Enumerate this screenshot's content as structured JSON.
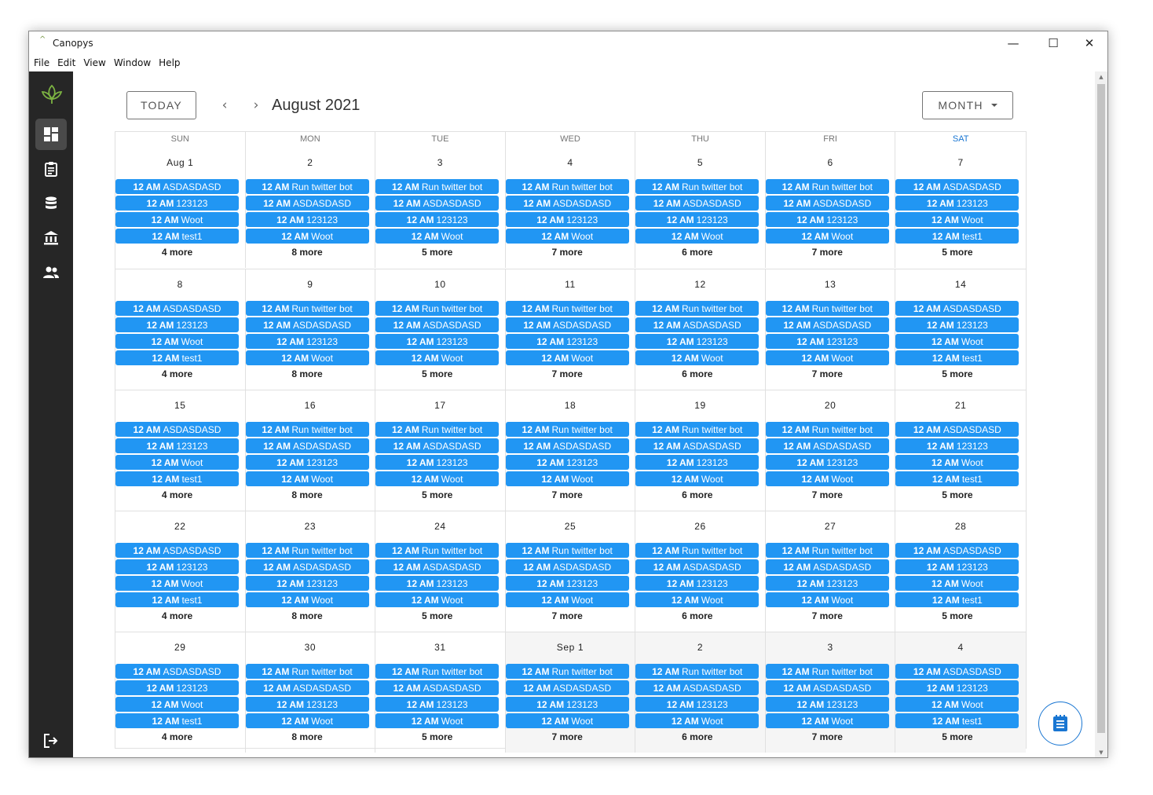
{
  "window": {
    "title": "Canopys",
    "app_icon": "^",
    "controls": {
      "minimize": "—",
      "maximize": "☐",
      "close": "✕"
    }
  },
  "menubar": [
    "File",
    "Edit",
    "View",
    "Window",
    "Help"
  ],
  "sidebar": {
    "logo": "canopy-leaf-logo",
    "items": [
      {
        "icon": "dashboard-icon",
        "active": true
      },
      {
        "icon": "clipboard-icon",
        "active": false
      },
      {
        "icon": "database-icon",
        "active": false
      },
      {
        "icon": "bank-icon",
        "active": false
      },
      {
        "icon": "people-icon",
        "active": false
      }
    ],
    "bottom_icon": "logout-icon"
  },
  "toolbar": {
    "today_label": "TODAY",
    "prev_icon": "‹",
    "next_icon": "›",
    "month_label": "August 2021",
    "view_label": "MONTH"
  },
  "calendar": {
    "days_of_week": [
      "SUN",
      "MON",
      "TUE",
      "WED",
      "THU",
      "FRI",
      "SAT"
    ],
    "weeks": [
      [
        {
          "label": "Aug 1",
          "events": [
            "ASDASDASD",
            "123123",
            "Woot",
            "test1"
          ],
          "more": "4 more"
        },
        {
          "label": "2",
          "events": [
            "Run twitter bot",
            "ASDASDASD",
            "123123",
            "Woot"
          ],
          "more": "8 more"
        },
        {
          "label": "3",
          "events": [
            "Run twitter bot",
            "ASDASDASD",
            "123123",
            "Woot"
          ],
          "more": "5 more"
        },
        {
          "label": "4",
          "events": [
            "Run twitter bot",
            "ASDASDASD",
            "123123",
            "Woot"
          ],
          "more": "7 more"
        },
        {
          "label": "5",
          "events": [
            "Run twitter bot",
            "ASDASDASD",
            "123123",
            "Woot"
          ],
          "more": "6 more"
        },
        {
          "label": "6",
          "events": [
            "Run twitter bot",
            "ASDASDASD",
            "123123",
            "Woot"
          ],
          "more": "7 more"
        },
        {
          "label": "7",
          "events": [
            "ASDASDASD",
            "123123",
            "Woot",
            "test1"
          ],
          "more": "5 more"
        }
      ],
      [
        {
          "label": "8",
          "events": [
            "ASDASDASD",
            "123123",
            "Woot",
            "test1"
          ],
          "more": "4 more"
        },
        {
          "label": "9",
          "events": [
            "Run twitter bot",
            "ASDASDASD",
            "123123",
            "Woot"
          ],
          "more": "8 more"
        },
        {
          "label": "10",
          "events": [
            "Run twitter bot",
            "ASDASDASD",
            "123123",
            "Woot"
          ],
          "more": "5 more"
        },
        {
          "label": "11",
          "events": [
            "Run twitter bot",
            "ASDASDASD",
            "123123",
            "Woot"
          ],
          "more": "7 more"
        },
        {
          "label": "12",
          "events": [
            "Run twitter bot",
            "ASDASDASD",
            "123123",
            "Woot"
          ],
          "more": "6 more"
        },
        {
          "label": "13",
          "events": [
            "Run twitter bot",
            "ASDASDASD",
            "123123",
            "Woot"
          ],
          "more": "7 more"
        },
        {
          "label": "14",
          "events": [
            "ASDASDASD",
            "123123",
            "Woot",
            "test1"
          ],
          "more": "5 more"
        }
      ],
      [
        {
          "label": "15",
          "events": [
            "ASDASDASD",
            "123123",
            "Woot",
            "test1"
          ],
          "more": "4 more"
        },
        {
          "label": "16",
          "events": [
            "Run twitter bot",
            "ASDASDASD",
            "123123",
            "Woot"
          ],
          "more": "8 more"
        },
        {
          "label": "17",
          "events": [
            "Run twitter bot",
            "ASDASDASD",
            "123123",
            "Woot"
          ],
          "more": "5 more"
        },
        {
          "label": "18",
          "events": [
            "Run twitter bot",
            "ASDASDASD",
            "123123",
            "Woot"
          ],
          "more": "7 more"
        },
        {
          "label": "19",
          "events": [
            "Run twitter bot",
            "ASDASDASD",
            "123123",
            "Woot"
          ],
          "more": "6 more"
        },
        {
          "label": "20",
          "events": [
            "Run twitter bot",
            "ASDASDASD",
            "123123",
            "Woot"
          ],
          "more": "7 more"
        },
        {
          "label": "21",
          "events": [
            "ASDASDASD",
            "123123",
            "Woot",
            "test1"
          ],
          "more": "5 more"
        }
      ],
      [
        {
          "label": "22",
          "events": [
            "ASDASDASD",
            "123123",
            "Woot",
            "test1"
          ],
          "more": "4 more"
        },
        {
          "label": "23",
          "events": [
            "Run twitter bot",
            "ASDASDASD",
            "123123",
            "Woot"
          ],
          "more": "8 more"
        },
        {
          "label": "24",
          "events": [
            "Run twitter bot",
            "ASDASDASD",
            "123123",
            "Woot"
          ],
          "more": "5 more"
        },
        {
          "label": "25",
          "events": [
            "Run twitter bot",
            "ASDASDASD",
            "123123",
            "Woot"
          ],
          "more": "7 more"
        },
        {
          "label": "26",
          "events": [
            "Run twitter bot",
            "ASDASDASD",
            "123123",
            "Woot"
          ],
          "more": "6 more"
        },
        {
          "label": "27",
          "events": [
            "Run twitter bot",
            "ASDASDASD",
            "123123",
            "Woot"
          ],
          "more": "7 more"
        },
        {
          "label": "28",
          "events": [
            "ASDASDASD",
            "123123",
            "Woot",
            "test1"
          ],
          "more": "5 more"
        }
      ],
      [
        {
          "label": "29",
          "events": [
            "ASDASDASD",
            "123123",
            "Woot",
            "test1"
          ],
          "more": "4 more"
        },
        {
          "label": "30",
          "events": [
            "Run twitter bot",
            "ASDASDASD",
            "123123",
            "Woot"
          ],
          "more": "8 more"
        },
        {
          "label": "31",
          "events": [
            "Run twitter bot",
            "ASDASDASD",
            "123123",
            "Woot"
          ],
          "more": "5 more"
        },
        {
          "label": "Sep 1",
          "outside": true,
          "events": [
            "Run twitter bot",
            "ASDASDASD",
            "123123",
            "Woot"
          ],
          "more": "7 more"
        },
        {
          "label": "2",
          "outside": true,
          "events": [
            "Run twitter bot",
            "ASDASDASD",
            "123123",
            "Woot"
          ],
          "more": "6 more"
        },
        {
          "label": "3",
          "outside": true,
          "events": [
            "Run twitter bot",
            "ASDASDASD",
            "123123",
            "Woot"
          ],
          "more": "7 more"
        },
        {
          "label": "4",
          "outside": true,
          "events": [
            "ASDASDASD",
            "123123",
            "Woot",
            "test1"
          ],
          "more": "5 more"
        }
      ]
    ],
    "event_time": "12 AM"
  },
  "fab": {
    "icon": "notes-icon"
  },
  "colors": {
    "event_bg": "#2196f3",
    "sidebar_bg": "#262626",
    "accent": "#1976d2"
  }
}
